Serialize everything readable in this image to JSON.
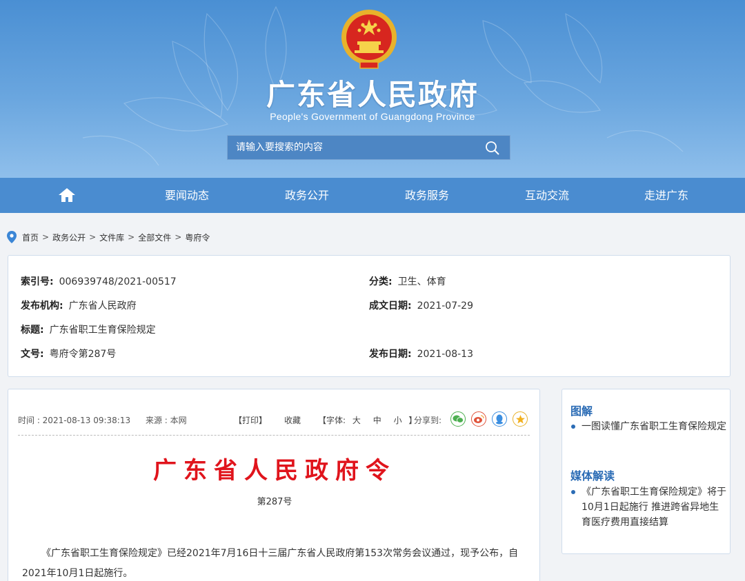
{
  "header": {
    "title": "广东省人民政府",
    "subtitle": "People's Government of Guangdong Province",
    "search_placeholder": "请输入要搜索的内容"
  },
  "nav": {
    "items": [
      "要闻动态",
      "政务公开",
      "政务服务",
      "互动交流",
      "走进广东"
    ]
  },
  "breadcrumb": [
    "首页",
    "政务公开",
    "文件库",
    "全部文件",
    "粤府令"
  ],
  "info": {
    "index_label": "索引号:",
    "index_value": "006939748/2021-00517",
    "category_label": "分类:",
    "category_value": "卫生、体育",
    "issuer_label": "发布机构:",
    "issuer_value": "广东省人民政府",
    "created_label": "成文日期:",
    "created_value": "2021-07-29",
    "title_label": "标题:",
    "title_value": "广东省职工生育保险规定",
    "docno_label": "文号:",
    "docno_value": "粤府令第287号",
    "published_label": "发布日期:",
    "published_value": "2021-08-13"
  },
  "article": {
    "time": "时间 : 2021-08-13 09:38:13",
    "source": "来源 : 本网",
    "print": "【打印】",
    "favorite": "收藏",
    "font_prefix": "【字体:",
    "font_large": "大",
    "font_medium": "中",
    "font_small": "小",
    "font_suffix": "】",
    "share_label": "分享到:",
    "order_title": "广东省人民政府令",
    "order_no": "第287号",
    "paragraph": "《广东省职工生育保险规定》已经2021年7月16日十三届广东省人民政府第153次常务会议通过，现予公布，自2021年10月1日起施行。"
  },
  "sidebar": {
    "section1_title": "图解",
    "section1_item": "一图读懂广东省职工生育保险规定",
    "section2_title": "媒体解读",
    "section2_item": "《广东省职工生育保险规定》将于10月1日起施行 推进跨省异地生育医疗费用直接结算"
  },
  "colors": {
    "nav_bg": "#4a8cd0",
    "accent": "#2b6cb5",
    "order_red": "#e0141c"
  },
  "icons": {
    "home": "home-icon",
    "search": "search-icon",
    "location": "location-pin-icon",
    "share": [
      "wechat-icon",
      "weibo-icon",
      "qq-icon",
      "qzone-icon"
    ]
  }
}
